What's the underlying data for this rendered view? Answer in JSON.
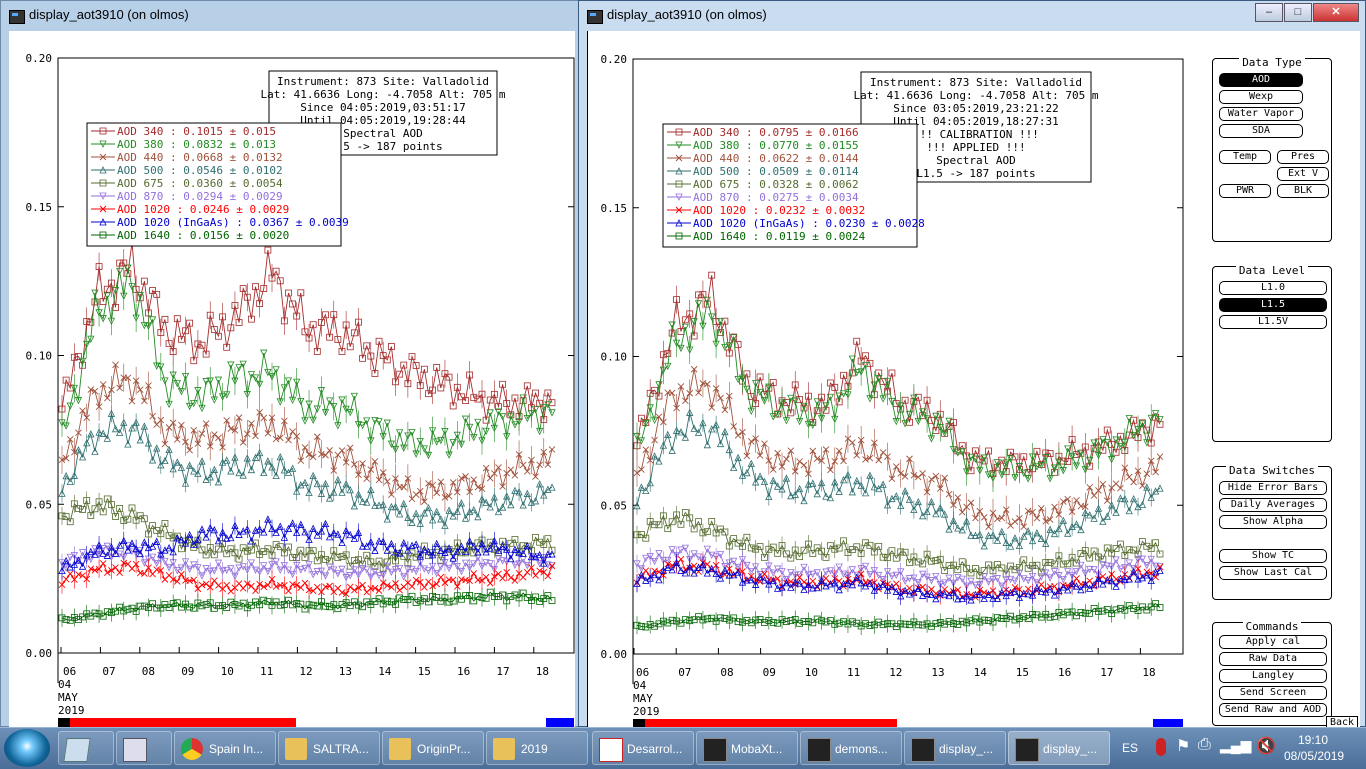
{
  "colors": {
    "aod340": "#a52a2a",
    "aod380": "#228b22",
    "aod440": "#a0523c",
    "aod500": "#2f6f6f",
    "aod675": "#556b2f",
    "aod870": "#9370db",
    "aod1020": "#ff0000",
    "ingaas": "#0000cd",
    "aod1640": "#006400"
  },
  "left_window": {
    "title": "display_aot3910 (on olmos)",
    "info": [
      "Instrument: 873 Site: Valladolid",
      "Lat: 41.6636 Long: -4.7058 Alt: 705 m",
      "Since 04:05:2019,03:51:17",
      "Until 04:05:2019,19:28:44",
      "Spectral AOD",
      "L1.5 -> 187 points"
    ],
    "legend": [
      "AOD 340   : 0.1015 ± 0.015",
      "AOD 380   : 0.0832 ± 0.013",
      "AOD 440   : 0.0668 ± 0.0132",
      "AOD 500   : 0.0546 ± 0.0102",
      "AOD 675   : 0.0360 ± 0.0054",
      "AOD 870   : 0.0294 ± 0.0029",
      "AOD 1020   : 0.0246 ± 0.0029",
      "AOD 1020 (InGaAs)   : 0.0367 ± 0.0039",
      "AOD 1640   : 0.0156 ± 0.0020"
    ]
  },
  "right_window": {
    "title": "display_aot3910 (on olmos)",
    "info": [
      "Instrument: 873 Site: Valladolid",
      "Lat: 41.6636 Long: -4.7058 Alt: 705 m",
      "Since 03:05:2019,23:21:22",
      "Until 04:05:2019,18:27:31",
      "!!! CALIBRATION !!!",
      "!!!   APPLIED   !!!",
      "Spectral AOD",
      "L1.5 -> 187 points"
    ],
    "legend": [
      "AOD 340   : 0.0795 ± 0.0166",
      "AOD 380   : 0.0770 ± 0.0155",
      "AOD 440   : 0.0622 ± 0.0144",
      "AOD 500   : 0.0509 ± 0.0114",
      "AOD 675   : 0.0328 ± 0.0062",
      "AOD 870   : 0.0275 ± 0.0034",
      "AOD 1020   : 0.0232 ± 0.0032",
      "AOD 1020 (InGaAs)   : 0.0230 ± 0.0028",
      "AOD 1640   : 0.0119 ± 0.0024"
    ],
    "back_label": "Back",
    "data_type": {
      "title": "Data Type",
      "buttons": [
        "AOD",
        "Wexp",
        "Water Vapor",
        "SDA",
        "Temp",
        "Pres",
        "Ext V",
        "PWR",
        "BLK"
      ],
      "selected": "AOD"
    },
    "data_level": {
      "title": "Data Level",
      "buttons": [
        "L1.0",
        "L1.5",
        "L1.5V"
      ],
      "selected": "L1.5"
    },
    "data_switches": {
      "title": "Data Switches",
      "buttons": [
        "Hide Error Bars",
        "Daily Averages",
        "Show Alpha",
        "Show TC",
        "Show Last Cal"
      ]
    },
    "commands": {
      "title": "Commands",
      "buttons": [
        "Apply cal",
        "Raw Data",
        "Langley",
        "Send Screen",
        "Send Raw and AOD"
      ]
    }
  },
  "chart_data": [
    {
      "type": "scatter",
      "title": "",
      "xlabel": "",
      "ylabel": "",
      "ylim": [
        0,
        0.2
      ],
      "yticks": [
        "0.00",
        "0.05",
        "0.10",
        "0.15",
        "0.20"
      ],
      "xticks": [
        "06",
        "07",
        "08",
        "09",
        "10",
        "11",
        "12",
        "13",
        "14",
        "15",
        "16",
        "17",
        "18"
      ],
      "xdate": [
        "04",
        "MAY",
        "2019"
      ],
      "series": [
        {
          "name": "AOD 340",
          "values": [
            0.082,
            0.12,
            0.13,
            0.108,
            0.104,
            0.113,
            0.128,
            0.109,
            0.108,
            0.1,
            0.094,
            0.09,
            0.085,
            0.084,
            0.085
          ]
        },
        {
          "name": "AOD 380",
          "values": [
            0.072,
            0.115,
            0.125,
            0.09,
            0.086,
            0.093,
            0.094,
            0.082,
            0.083,
            0.075,
            0.07,
            0.071,
            0.076,
            0.079,
            0.082
          ]
        },
        {
          "name": "AOD 440",
          "values": [
            0.064,
            0.088,
            0.092,
            0.074,
            0.072,
            0.075,
            0.077,
            0.068,
            0.066,
            0.06,
            0.054,
            0.055,
            0.058,
            0.062,
            0.065
          ]
        },
        {
          "name": "AOD 500",
          "values": [
            0.056,
            0.074,
            0.076,
            0.064,
            0.06,
            0.063,
            0.064,
            0.056,
            0.055,
            0.05,
            0.046,
            0.046,
            0.049,
            0.052,
            0.054
          ]
        },
        {
          "name": "AOD 675",
          "values": [
            0.046,
            0.05,
            0.046,
            0.04,
            0.035,
            0.034,
            0.035,
            0.033,
            0.032,
            0.03,
            0.033,
            0.034,
            0.036,
            0.036,
            0.037
          ]
        },
        {
          "name": "AOD 870",
          "values": [
            0.03,
            0.034,
            0.034,
            0.03,
            0.028,
            0.028,
            0.029,
            0.028,
            0.027,
            0.027,
            0.028,
            0.029,
            0.03,
            0.031,
            0.031
          ]
        },
        {
          "name": "AOD 1020",
          "values": [
            0.024,
            0.028,
            0.029,
            0.026,
            0.023,
            0.022,
            0.023,
            0.022,
            0.021,
            0.022,
            0.023,
            0.024,
            0.025,
            0.026,
            0.028
          ]
        },
        {
          "name": "AOD 1020 (InGaAs)",
          "values": [
            0.028,
            0.034,
            0.036,
            0.035,
            0.04,
            0.04,
            0.042,
            0.041,
            0.04,
            0.036,
            0.035,
            0.034,
            0.036,
            0.034,
            0.032
          ]
        },
        {
          "name": "AOD 1640",
          "values": [
            0.011,
            0.013,
            0.015,
            0.016,
            0.016,
            0.016,
            0.017,
            0.016,
            0.016,
            0.017,
            0.018,
            0.018,
            0.019,
            0.019,
            0.018
          ]
        }
      ]
    },
    {
      "type": "scatter",
      "title": "",
      "xlabel": "",
      "ylabel": "",
      "ylim": [
        0,
        0.2
      ],
      "yticks": [
        "0.00",
        "0.05",
        "0.10",
        "0.15",
        "0.20"
      ],
      "xticks": [
        "06",
        "07",
        "08",
        "09",
        "10",
        "11",
        "12",
        "13",
        "14",
        "15",
        "16",
        "17",
        "18"
      ],
      "xdate": [
        "04",
        "MAY",
        "2019"
      ],
      "series": [
        {
          "name": "AOD 340",
          "values": [
            0.07,
            0.11,
            0.12,
            0.09,
            0.085,
            0.083,
            0.1,
            0.085,
            0.08,
            0.065,
            0.064,
            0.065,
            0.068,
            0.072,
            0.078
          ]
        },
        {
          "name": "AOD 380",
          "values": [
            0.068,
            0.105,
            0.115,
            0.088,
            0.082,
            0.08,
            0.096,
            0.082,
            0.078,
            0.063,
            0.062,
            0.063,
            0.066,
            0.072,
            0.08
          ]
        },
        {
          "name": "AOD 440",
          "values": [
            0.06,
            0.088,
            0.09,
            0.07,
            0.064,
            0.065,
            0.07,
            0.062,
            0.058,
            0.047,
            0.045,
            0.047,
            0.052,
            0.058,
            0.063
          ]
        },
        {
          "name": "AOD 500",
          "values": [
            0.052,
            0.075,
            0.076,
            0.06,
            0.055,
            0.055,
            0.058,
            0.052,
            0.048,
            0.04,
            0.038,
            0.04,
            0.045,
            0.05,
            0.054
          ]
        },
        {
          "name": "AOD 675",
          "values": [
            0.04,
            0.046,
            0.042,
            0.036,
            0.034,
            0.035,
            0.036,
            0.033,
            0.031,
            0.028,
            0.029,
            0.03,
            0.033,
            0.035,
            0.036
          ]
        },
        {
          "name": "AOD 870",
          "values": [
            0.03,
            0.034,
            0.033,
            0.029,
            0.027,
            0.027,
            0.028,
            0.026,
            0.025,
            0.024,
            0.025,
            0.026,
            0.028,
            0.03,
            0.031
          ]
        },
        {
          "name": "AOD 1020",
          "values": [
            0.025,
            0.03,
            0.029,
            0.026,
            0.024,
            0.024,
            0.025,
            0.022,
            0.021,
            0.02,
            0.021,
            0.022,
            0.024,
            0.026,
            0.028
          ]
        },
        {
          "name": "AOD 1020 (InGaAs)",
          "values": [
            0.024,
            0.029,
            0.028,
            0.025,
            0.023,
            0.023,
            0.024,
            0.021,
            0.02,
            0.019,
            0.02,
            0.021,
            0.023,
            0.025,
            0.027
          ]
        },
        {
          "name": "AOD 1640",
          "values": [
            0.009,
            0.011,
            0.012,
            0.011,
            0.011,
            0.011,
            0.01,
            0.01,
            0.01,
            0.011,
            0.012,
            0.013,
            0.014,
            0.015,
            0.016
          ]
        }
      ]
    }
  ],
  "taskbar": {
    "items": [
      "",
      "",
      "",
      "Spain In...",
      "SALTRA...",
      "OriginPr...",
      "2019",
      "Desarrol...",
      "MobaXt...",
      "demons...",
      "display_...",
      "display_..."
    ],
    "lang": "ES",
    "time": "19:10",
    "date": "08/05/2019"
  }
}
